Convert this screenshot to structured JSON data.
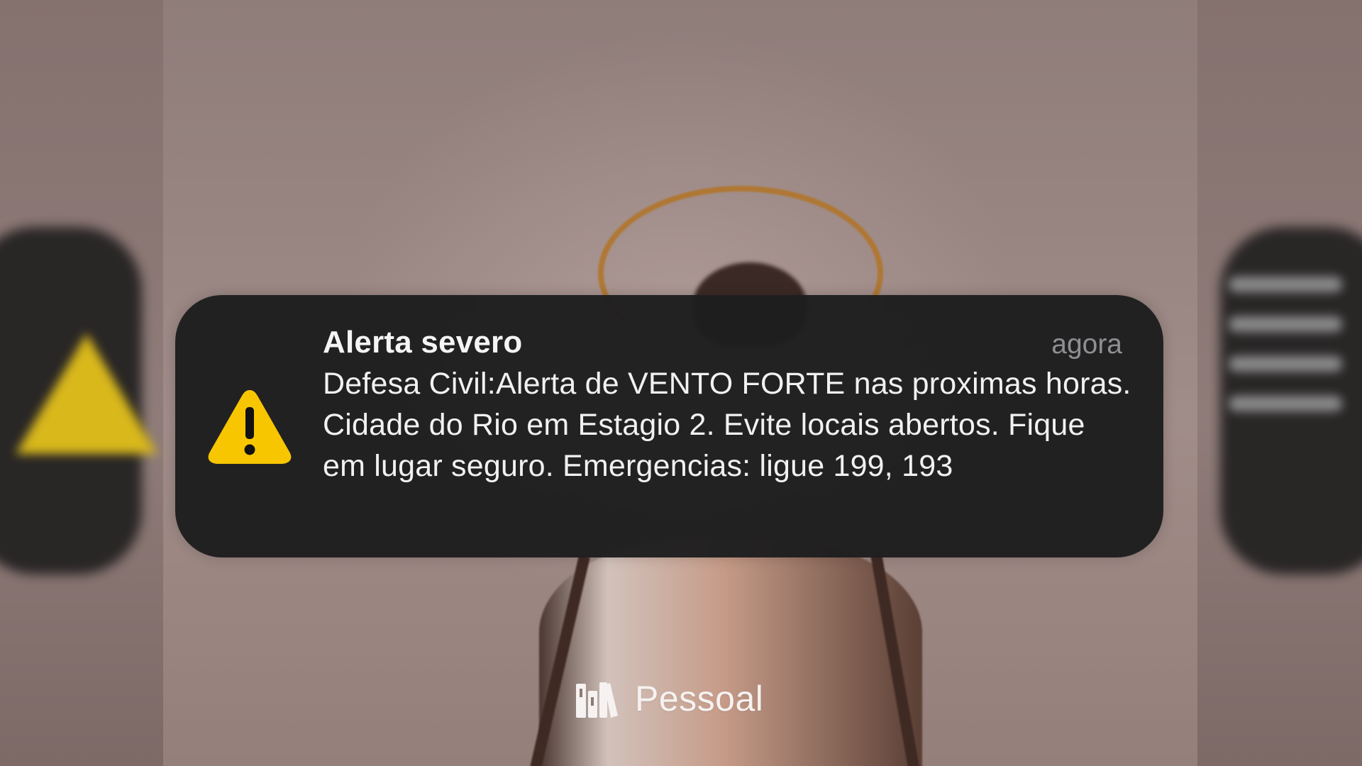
{
  "notification": {
    "title": "Alerta severo",
    "time": "agora",
    "body": "Defesa Civil:Alerta de VENTO FORTE nas proximas horas. Cidade do Rio em Estagio 2. Evite locais abertos. Fique em lugar seguro. Emergencias: ligue 199, 193",
    "icon": "warning-triangle-icon"
  },
  "focus_mode": {
    "label": "Pessoal",
    "icon": "books-icon"
  },
  "colors": {
    "notification_background": "#1e1e1f",
    "warning": "#f7c600",
    "text": "#f1f1f1",
    "secondary_text": "#8f8f93"
  }
}
